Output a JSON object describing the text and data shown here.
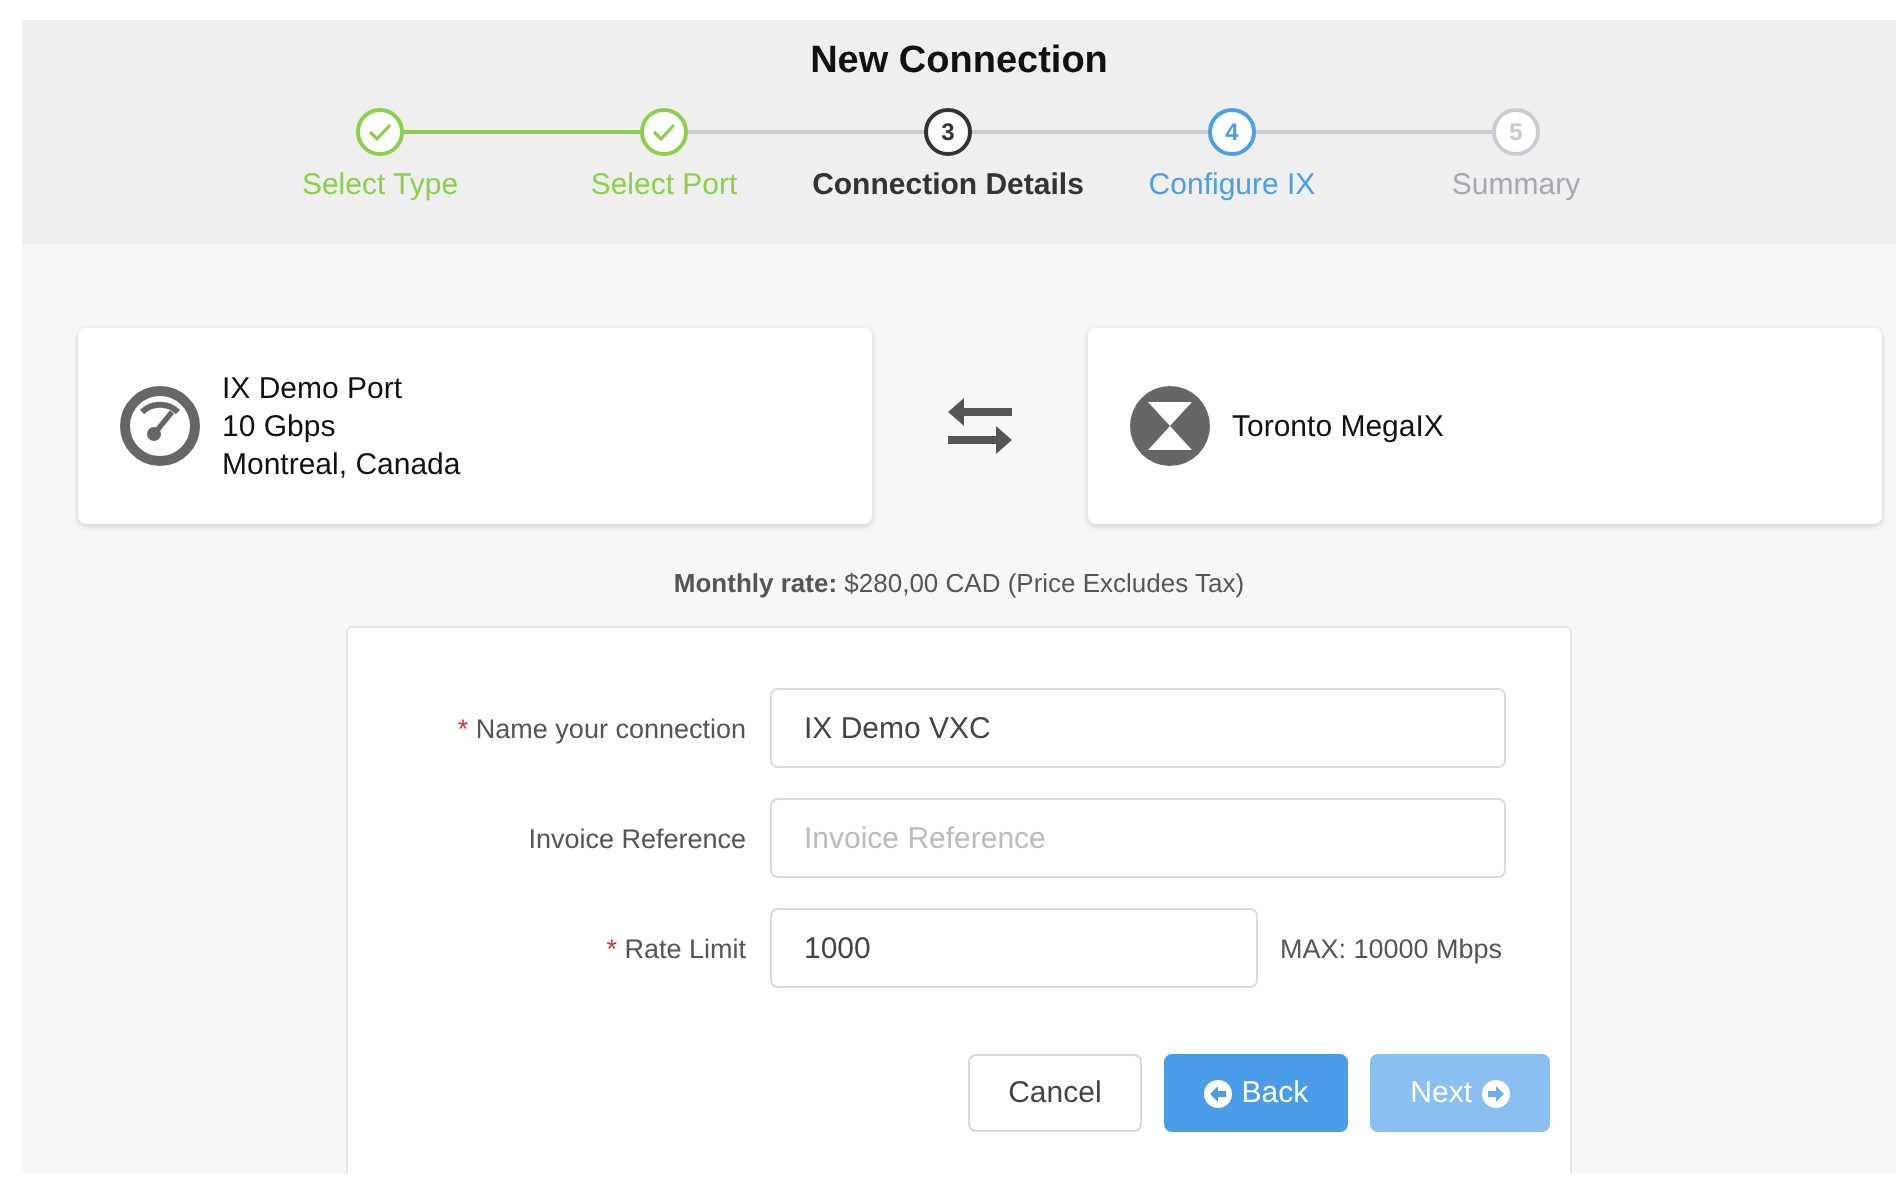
{
  "title": "New Connection",
  "steps": [
    {
      "label": "Select Type",
      "kind": "done"
    },
    {
      "label": "Select Port",
      "kind": "done"
    },
    {
      "number": "3",
      "label": "Connection Details",
      "kind": "current"
    },
    {
      "number": "4",
      "label": "Configure IX",
      "kind": "next"
    },
    {
      "number": "5",
      "label": "Summary",
      "kind": "pending"
    }
  ],
  "required_marker": "*",
  "source": {
    "name": "IX Demo Port",
    "speed": "10 Gbps",
    "location": "Montreal, Canada"
  },
  "destination": {
    "name": "Toronto MegaIX"
  },
  "rate": {
    "label": "Monthly rate:",
    "value": "$280,00 CAD (Price Excludes Tax)"
  },
  "fields": [
    {
      "label": "Name your connection",
      "required": true,
      "value": "IX Demo VXC"
    },
    {
      "label": "Invoice Reference",
      "required": false,
      "placeholder": "Invoice Reference"
    },
    {
      "label": "Rate Limit",
      "required": true,
      "value": "1000",
      "hint": "MAX: 10000 Mbps"
    }
  ],
  "buttons": [
    {
      "label": "Cancel",
      "kind": "plain",
      "disabled": false
    },
    {
      "label": "Back",
      "kind": "back",
      "disabled": false
    },
    {
      "label": "Next",
      "kind": "next",
      "disabled": true
    }
  ]
}
